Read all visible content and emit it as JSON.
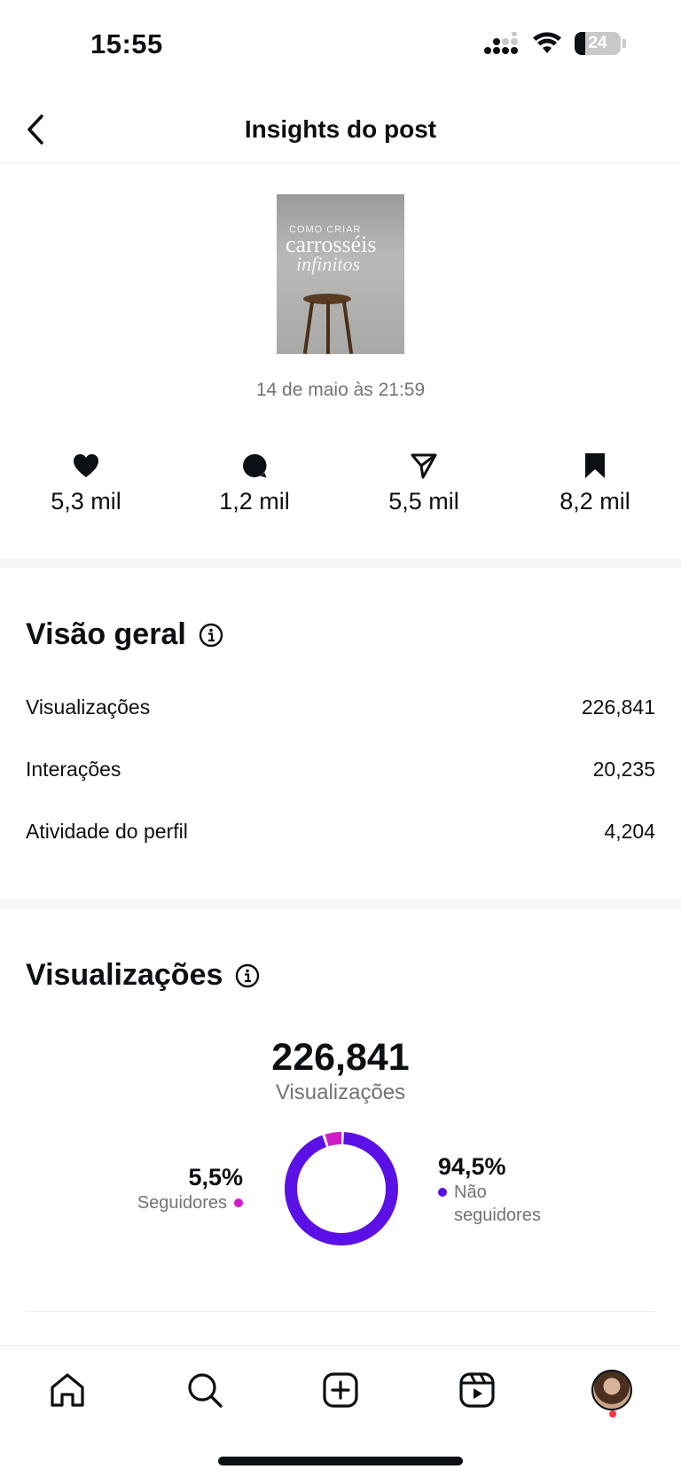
{
  "status_bar": {
    "time": "15:55",
    "battery": "24"
  },
  "header": {
    "title": "Insights do post",
    "back_icon": "chevron-left-icon"
  },
  "post": {
    "thumbnail_text_line1": "COMO CRIAR",
    "thumbnail_text_line2": "carrosséis",
    "thumbnail_text_line3": "infinitos",
    "date": "14 de maio às 21:59"
  },
  "stats": [
    {
      "icon": "heart-icon",
      "value": "5,3 mil"
    },
    {
      "icon": "comment-icon",
      "value": "1,2 mil"
    },
    {
      "icon": "share-icon",
      "value": "5,5 mil"
    },
    {
      "icon": "bookmark-icon",
      "value": "8,2 mil"
    }
  ],
  "overview": {
    "title": "Visão geral",
    "rows": [
      {
        "label": "Visualizações",
        "value": "226,841"
      },
      {
        "label": "Interações",
        "value": "20,235"
      },
      {
        "label": "Atividade do perfil",
        "value": "4,204"
      }
    ]
  },
  "views": {
    "title": "Visualizações",
    "total": "226,841",
    "total_label": "Visualizações",
    "followers_pct": "5,5%",
    "followers_label": "Seguidores",
    "nonfollowers_pct": "94,5%",
    "nonfollowers_label_1": "Não",
    "nonfollowers_label_2": "seguidores"
  },
  "colors": {
    "followers": "#d21bc6",
    "nonfollowers": "#5b10e6"
  },
  "chart_data": {
    "type": "pie",
    "categories": [
      "Seguidores",
      "Não seguidores"
    ],
    "values": [
      5.5,
      94.5
    ]
  },
  "tab_bar": {
    "items": [
      "home-icon",
      "search-icon",
      "create-icon",
      "reels-icon",
      "profile-avatar"
    ]
  }
}
